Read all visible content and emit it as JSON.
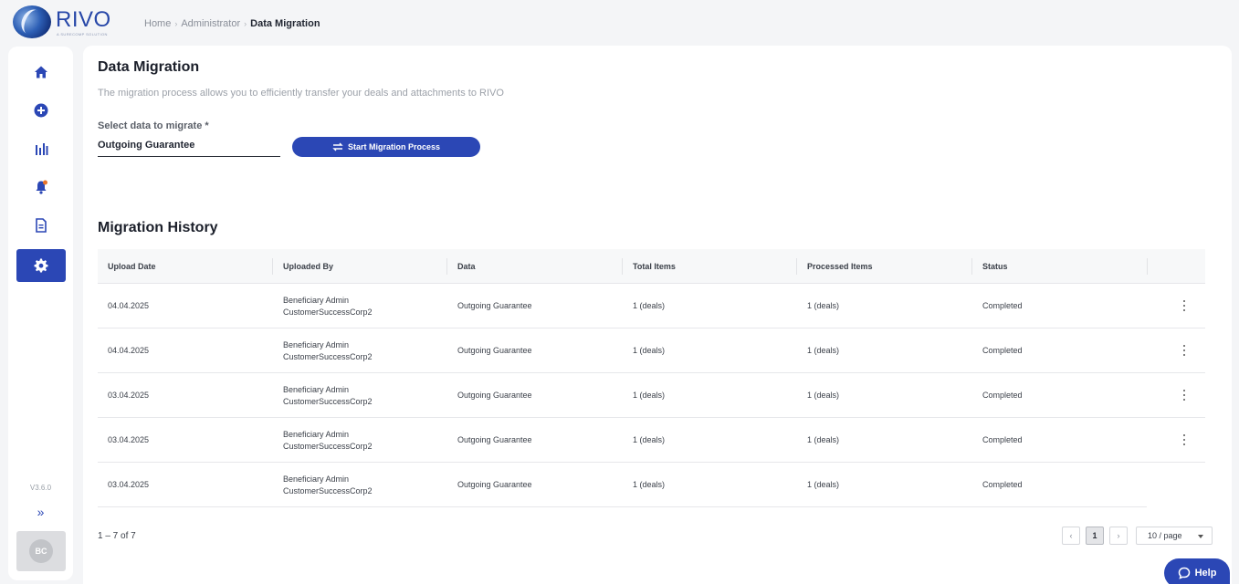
{
  "app": {
    "brand": "RIVO",
    "brand_sub": "A SURECOMP SOLUTION",
    "accent_color": "#2b47b5"
  },
  "breadcrumb": [
    "Home",
    "Administrator",
    "Data Migration"
  ],
  "sidebar": {
    "items": [
      {
        "icon": "home-icon",
        "active": false
      },
      {
        "icon": "plus-circle-icon",
        "active": false
      },
      {
        "icon": "bar-chart-icon",
        "active": false
      },
      {
        "icon": "bell-icon",
        "active": false
      },
      {
        "icon": "document-icon",
        "active": false
      },
      {
        "icon": "gear-icon",
        "active": true
      }
    ],
    "version": "V3.6.0",
    "expand_glyph": "»",
    "avatar_initials": "BC"
  },
  "page": {
    "title": "Data Migration",
    "description": "The migration process allows you to efficiently transfer your deals and attachments to RIVO",
    "select_label": "Select data to migrate *",
    "select_value": "Outgoing Guarantee",
    "start_button": "Start Migration Process"
  },
  "history": {
    "title": "Migration History",
    "columns": [
      "Upload Date",
      "Uploaded By",
      "Data",
      "Total Items",
      "Processed Items",
      "Status"
    ],
    "rows": [
      {
        "date": "04.04.2025",
        "user": "Beneficiary Admin",
        "org": "CustomerSuccessCorp2",
        "data": "Outgoing Guarantee",
        "total": "1 (deals)",
        "processed": "1 (deals)",
        "status": "Completed"
      },
      {
        "date": "04.04.2025",
        "user": "Beneficiary Admin",
        "org": "CustomerSuccessCorp2",
        "data": "Outgoing Guarantee",
        "total": "1 (deals)",
        "processed": "1 (deals)",
        "status": "Completed"
      },
      {
        "date": "03.04.2025",
        "user": "Beneficiary Admin",
        "org": "CustomerSuccessCorp2",
        "data": "Outgoing Guarantee",
        "total": "1 (deals)",
        "processed": "1 (deals)",
        "status": "Completed"
      },
      {
        "date": "03.04.2025",
        "user": "Beneficiary Admin",
        "org": "CustomerSuccessCorp2",
        "data": "Outgoing Guarantee",
        "total": "1 (deals)",
        "processed": "1 (deals)",
        "status": "Completed"
      },
      {
        "date": "03.04.2025",
        "user": "Beneficiary Admin",
        "org": "CustomerSuccessCorp2",
        "data": "Outgoing Guarantee",
        "total": "1 (deals)",
        "processed": "1 (deals)",
        "status": "Completed"
      }
    ]
  },
  "pagination": {
    "summary": "1 – 7 of 7",
    "prev": "‹",
    "page": "1",
    "next": "›",
    "per_page": "10 / page"
  },
  "help": {
    "label": "Help"
  }
}
